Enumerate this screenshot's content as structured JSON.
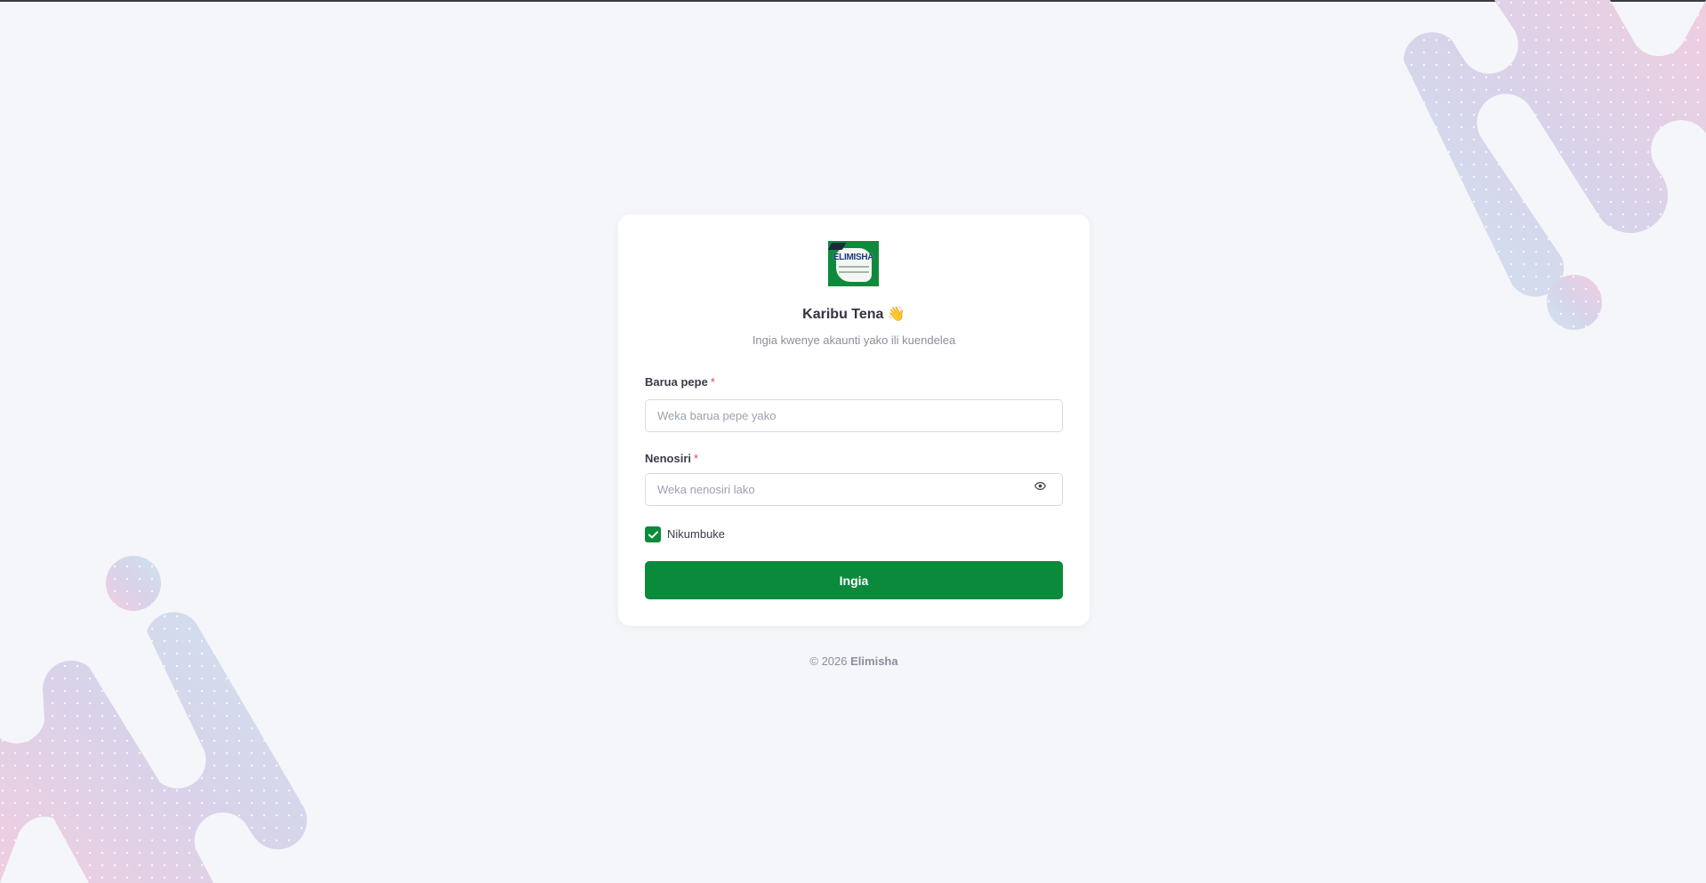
{
  "brand": {
    "name": "Elimisha",
    "logo_text": "ELIMISHA",
    "accent_color": "#0a8a3b"
  },
  "login": {
    "title": "Karibu Tena",
    "title_emoji": "👋",
    "subtitle": "Ingia kwenye akaunti yako ili kuendelea",
    "email_label": "Barua pepe",
    "email_placeholder": "Weka barua pepe yako",
    "email_value": "",
    "password_label": "Nenosiri",
    "password_placeholder": "Weka nenosiri lako",
    "password_value": "",
    "required_marker": "*",
    "remember_label": "Nikumbuke",
    "remember_checked": true,
    "submit_label": "Ingia",
    "eye_icon": "eye-icon",
    "check_icon": "checkmark-icon"
  },
  "footer": {
    "copyright": "© 2026",
    "brand": "Elimisha"
  }
}
